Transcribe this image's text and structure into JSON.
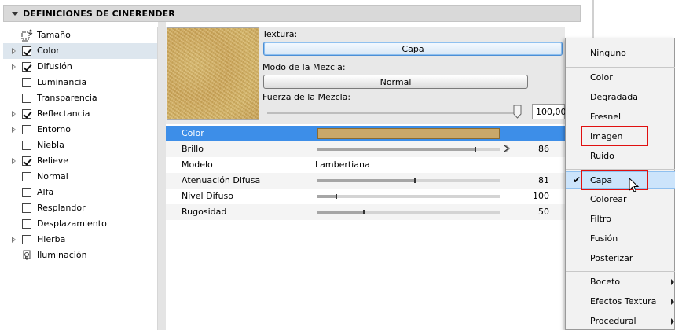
{
  "header": {
    "title": "DEFINICIONES DE CINERENDER"
  },
  "left_list": [
    {
      "label": "Tamaño",
      "type": "icon",
      "icon": "resize-icon",
      "expandable": false,
      "checked": null
    },
    {
      "label": "Color",
      "type": "check",
      "expandable": true,
      "checked": true,
      "selected": true
    },
    {
      "label": "Difusión",
      "type": "check",
      "expandable": true,
      "checked": true
    },
    {
      "label": "Luminancia",
      "type": "check",
      "expandable": false,
      "checked": false
    },
    {
      "label": "Transparencia",
      "type": "check",
      "expandable": false,
      "checked": false
    },
    {
      "label": "Reflectancia",
      "type": "check",
      "expandable": true,
      "checked": true
    },
    {
      "label": "Entorno",
      "type": "check",
      "expandable": true,
      "checked": false
    },
    {
      "label": "Niebla",
      "type": "check",
      "expandable": false,
      "checked": false
    },
    {
      "label": "Relieve",
      "type": "check",
      "expandable": true,
      "checked": true
    },
    {
      "label": "Normal",
      "type": "check",
      "expandable": false,
      "checked": false
    },
    {
      "label": "Alfa",
      "type": "check",
      "expandable": false,
      "checked": false
    },
    {
      "label": "Resplandor",
      "type": "check",
      "expandable": false,
      "checked": false
    },
    {
      "label": "Desplazamiento",
      "type": "check",
      "expandable": false,
      "checked": false
    },
    {
      "label": "Hierba",
      "type": "check",
      "expandable": true,
      "checked": false
    },
    {
      "label": "Iluminación",
      "type": "icon",
      "icon": "lightbulb-icon",
      "expandable": false,
      "checked": null
    }
  ],
  "settings": {
    "texture_label": "Textura:",
    "texture_value": "Capa",
    "blend_mode_label": "Modo de la Mezcla:",
    "blend_mode_value": "Normal",
    "blend_strength_label": "Fuerza de la Mezcla:",
    "blend_strength_value": "100,00",
    "blend_strength_fraction": 1.0
  },
  "properties": [
    {
      "label": "Color",
      "kind": "color",
      "color": "#c9a86a",
      "selected": true
    },
    {
      "label": "Brillo",
      "kind": "slider",
      "value": "86",
      "fraction": 0.86,
      "spin": true
    },
    {
      "label": "Modelo",
      "kind": "text",
      "text": "Lambertiana"
    },
    {
      "label": "Atenuación Difusa",
      "kind": "slider",
      "value": "81",
      "fraction": 0.53
    },
    {
      "label": "Nivel Difuso",
      "kind": "slider",
      "value": "100",
      "fraction": 0.1
    },
    {
      "label": "Rugosidad",
      "kind": "slider",
      "value": "50",
      "fraction": 0.25
    }
  ],
  "menu": {
    "items": [
      {
        "label": "Ninguno"
      },
      {
        "sep": true
      },
      {
        "label": "Color"
      },
      {
        "label": "Degradada"
      },
      {
        "label": "Fresnel"
      },
      {
        "label": "Imagen",
        "highlight": true
      },
      {
        "label": "Ruido"
      },
      {
        "sep": true
      },
      {
        "label": "Capa",
        "checked": true,
        "selected": true,
        "highlight": true
      },
      {
        "label": "Colorear"
      },
      {
        "label": "Filtro"
      },
      {
        "label": "Fusión"
      },
      {
        "label": "Posterizar"
      },
      {
        "sep": true
      },
      {
        "label": "Boceto",
        "submenu": true
      },
      {
        "label": "Efectos Textura",
        "submenu": true
      },
      {
        "label": "Procedural",
        "submenu": true
      }
    ]
  },
  "colors": {
    "selection": "#3d8ee8",
    "highlight_box": "#e01010",
    "menu_selected": "#cce4fb"
  }
}
